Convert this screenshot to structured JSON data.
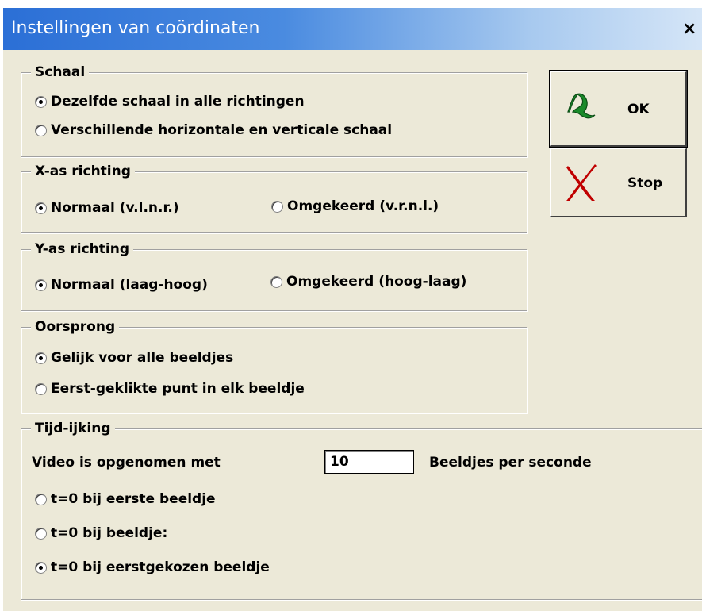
{
  "window": {
    "title": "Instellingen van coördinaten",
    "close_glyph": "×"
  },
  "groups": {
    "schaal": {
      "legend": "Schaal",
      "options": [
        {
          "label": "Dezelfde schaal in alle richtingen",
          "checked": true
        },
        {
          "label": "Verschillende horizontale en verticale schaal",
          "checked": false
        }
      ]
    },
    "xas": {
      "legend": "X-as richting",
      "options": [
        {
          "label": "Normaal (v.l.n.r.)",
          "checked": true
        },
        {
          "label": "Omgekeerd (v.r.n.l.)",
          "checked": false
        }
      ]
    },
    "yas": {
      "legend": "Y-as richting",
      "options": [
        {
          "label": "Normaal (laag-hoog)",
          "checked": true
        },
        {
          "label": "Omgekeerd (hoog-laag)",
          "checked": false
        }
      ]
    },
    "oorsprong": {
      "legend": "Oorsprong",
      "options": [
        {
          "label": "Gelijk voor alle beeldjes",
          "checked": true
        },
        {
          "label": "Eerst-geklikte punt in elk beeldje",
          "checked": false
        }
      ]
    },
    "tijd": {
      "legend": "Tijd-ijking",
      "video_label": "Video is opgenomen met",
      "fps_value": "10",
      "fps_unit": "Beeldjes per seconde",
      "options": [
        {
          "label": "t=0 bij eerste beeldje",
          "checked": false
        },
        {
          "label": "t=0 bij beeldje:",
          "checked": false
        },
        {
          "label": "t=0 bij eerstgekozen beeldje",
          "checked": true
        }
      ]
    }
  },
  "buttons": {
    "ok": {
      "label": "OK",
      "icon": "green-check-icon",
      "color": "#1a8a2a"
    },
    "stop": {
      "label": "Stop",
      "icon": "red-x-icon",
      "color": "#c00000"
    }
  }
}
